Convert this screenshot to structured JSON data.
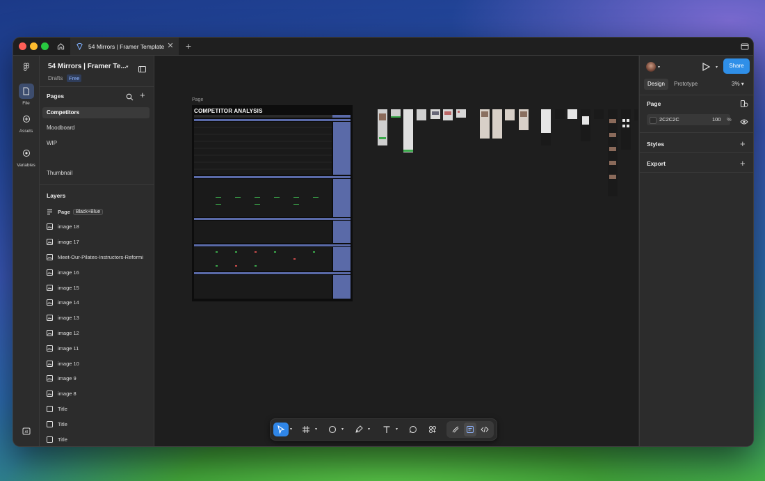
{
  "window": {
    "tab_title": "54 Mirrors | Framer Template"
  },
  "rail": {
    "file": "File",
    "assets": "Assets",
    "variables": "Variables"
  },
  "left_panel": {
    "project_title": "54 Mirrors | Framer Te...",
    "drafts": "Drafts",
    "plan_badge": "Free",
    "pages_header": "Pages",
    "pages": [
      {
        "label": "Competitors",
        "selected": true
      },
      {
        "label": "Moodboard"
      },
      {
        "label": "WIP"
      },
      {
        "label": "Thumbnail"
      }
    ],
    "layers_header": "Layers",
    "layers": [
      {
        "label": "Page",
        "badge": "Black+Blue",
        "icon": "page-icon"
      },
      {
        "label": "image 18",
        "icon": "image-icon"
      },
      {
        "label": "image 17",
        "icon": "image-icon"
      },
      {
        "label": "Meet-Our-Pilates-Instructors-Reformi",
        "icon": "image-icon"
      },
      {
        "label": "image 16",
        "icon": "image-icon"
      },
      {
        "label": "image 15",
        "icon": "image-icon"
      },
      {
        "label": "image 14",
        "icon": "image-icon"
      },
      {
        "label": "image 13",
        "icon": "image-icon"
      },
      {
        "label": "image 12",
        "icon": "image-icon"
      },
      {
        "label": "image 11",
        "icon": "image-icon"
      },
      {
        "label": "image 10",
        "icon": "image-icon"
      },
      {
        "label": "image 9",
        "icon": "image-icon"
      },
      {
        "label": "image 8",
        "icon": "image-icon"
      },
      {
        "label": "Title",
        "icon": "frame-icon"
      },
      {
        "label": "Title",
        "icon": "frame-icon"
      },
      {
        "label": "Title",
        "icon": "frame-icon"
      }
    ]
  },
  "canvas": {
    "page_label": "Page",
    "frame_title": "COMPETITOR ANALYSIS",
    "colors": {
      "canvas_bg": "#1e1e1e",
      "frame_accent": "#5a6aa8",
      "frame_bg": "#0d0d0d"
    }
  },
  "right_panel": {
    "share_label": "Share",
    "tabs": [
      {
        "label": "Design",
        "active": true
      },
      {
        "label": "Prototype"
      }
    ],
    "zoom": "3%",
    "page_section": "Page",
    "page_color_hex": "2C2C2C",
    "page_color_opacity": "100",
    "page_color_unit": "%",
    "styles_section": "Styles",
    "export_section": "Export",
    "accent_color": "#2f8fe8"
  },
  "help_label": "?"
}
